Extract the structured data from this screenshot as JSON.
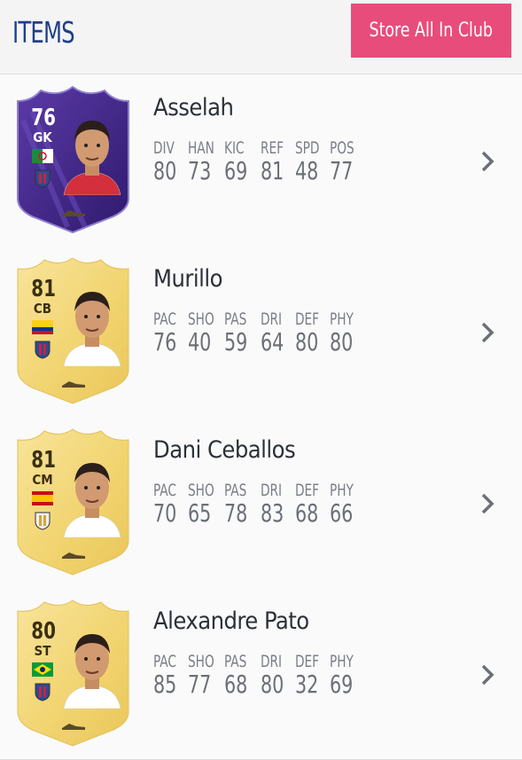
{
  "header": {
    "title": "ITEMS",
    "store_button": "Store All In Club"
  },
  "colors": {
    "accent": "#e84c7b",
    "title": "#1f3f8a",
    "gold": "#f5dc7e",
    "purple": "#4a2a8c"
  },
  "players": [
    {
      "name": "Asselah",
      "rating": "76",
      "position": "GK",
      "card": "purple",
      "flag": "algeria-flag",
      "club": "club-crest",
      "stats": [
        {
          "label": "DIV",
          "value": "80"
        },
        {
          "label": "HAN",
          "value": "73"
        },
        {
          "label": "KIC",
          "value": "69"
        },
        {
          "label": "REF",
          "value": "81"
        },
        {
          "label": "SPD",
          "value": "48"
        },
        {
          "label": "POS",
          "value": "77"
        }
      ]
    },
    {
      "name": "Murillo",
      "rating": "81",
      "position": "CB",
      "card": "gold",
      "flag": "colombia-flag",
      "club": "barcelona-crest",
      "stats": [
        {
          "label": "PAC",
          "value": "76"
        },
        {
          "label": "SHO",
          "value": "40"
        },
        {
          "label": "PAS",
          "value": "59"
        },
        {
          "label": "DRI",
          "value": "64"
        },
        {
          "label": "DEF",
          "value": "80"
        },
        {
          "label": "PHY",
          "value": "80"
        }
      ]
    },
    {
      "name": "Dani Ceballos",
      "rating": "81",
      "position": "CM",
      "card": "gold",
      "flag": "spain-flag",
      "club": "real-madrid-crest",
      "stats": [
        {
          "label": "PAC",
          "value": "70"
        },
        {
          "label": "SHO",
          "value": "65"
        },
        {
          "label": "PAS",
          "value": "78"
        },
        {
          "label": "DRI",
          "value": "83"
        },
        {
          "label": "DEF",
          "value": "68"
        },
        {
          "label": "PHY",
          "value": "66"
        }
      ]
    },
    {
      "name": "Alexandre Pato",
      "rating": "80",
      "position": "ST",
      "card": "gold",
      "flag": "brazil-flag",
      "club": "club-crest",
      "stats": [
        {
          "label": "PAC",
          "value": "85"
        },
        {
          "label": "SHO",
          "value": "77"
        },
        {
          "label": "PAS",
          "value": "68"
        },
        {
          "label": "DRI",
          "value": "80"
        },
        {
          "label": "DEF",
          "value": "32"
        },
        {
          "label": "PHY",
          "value": "69"
        }
      ]
    }
  ]
}
